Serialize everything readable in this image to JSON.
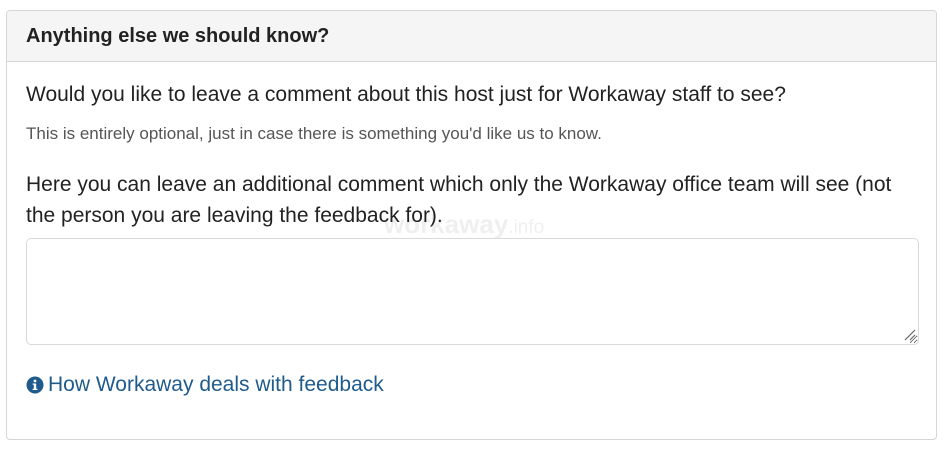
{
  "panel": {
    "title": "Anything else we should know?"
  },
  "form": {
    "question": "Would you like to leave a comment about this host just for Workaway staff to see?",
    "hint": "This is entirely optional, just in case there is something you'd like us to know.",
    "description": "Here you can leave an additional comment which only the Workaway office team will see (not the person you are leaving the feedback for).",
    "comment_value": "",
    "comment_placeholder": ""
  },
  "watermark": {
    "brand": "workaway",
    "tld": ".info"
  },
  "link": {
    "icon": "info-circle-icon",
    "label": "How Workaway deals with feedback",
    "color": "#1f5b8c"
  }
}
